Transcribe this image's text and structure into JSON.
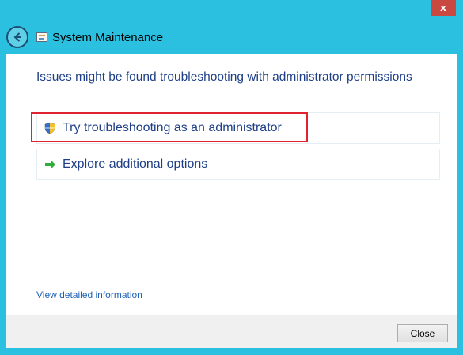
{
  "window": {
    "title": "System Maintenance",
    "close_glyph": "x"
  },
  "content": {
    "heading": "Issues might be found troubleshooting with administrator permissions",
    "options": [
      {
        "label": "Try troubleshooting as an administrator",
        "icon": "shield-icon"
      },
      {
        "label": "Explore additional options",
        "icon": "green-arrow-icon"
      }
    ],
    "details_link": "View detailed information"
  },
  "footer": {
    "close_label": "Close"
  },
  "colors": {
    "frame": "#2bbfe0",
    "heading_text": "#1e3f87",
    "link": "#1f62b8",
    "highlight_box": "#e0232e"
  }
}
